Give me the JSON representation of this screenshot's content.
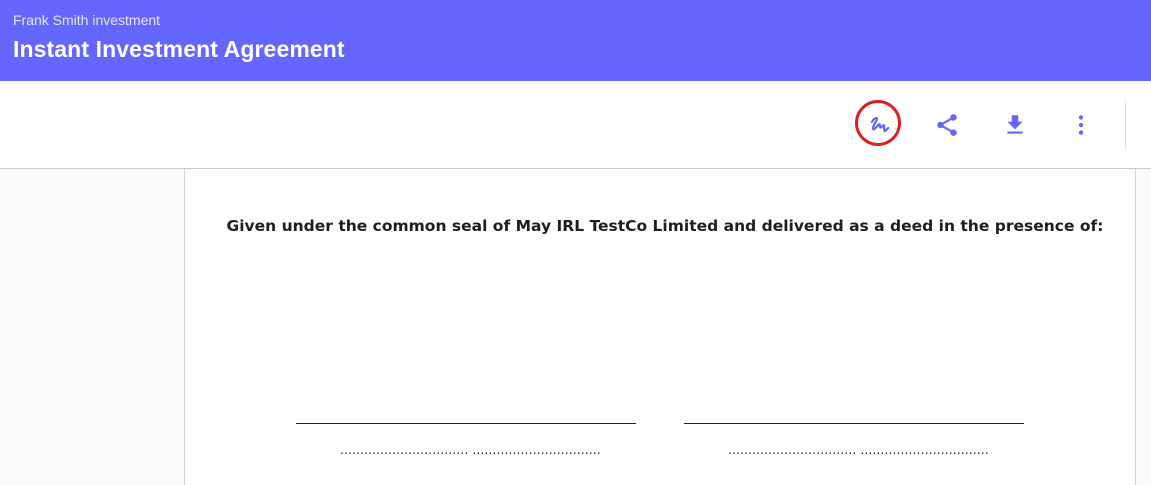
{
  "header": {
    "subtitle": "Frank Smith investment",
    "title": "Instant Investment Agreement",
    "background_color": "#6466fe"
  },
  "toolbar": {
    "buttons": [
      {
        "name": "sign",
        "icon": "signature-icon",
        "highlighted": true,
        "highlight_color": "#e01b24"
      },
      {
        "name": "share",
        "icon": "share-icon"
      },
      {
        "name": "download",
        "icon": "download-icon"
      },
      {
        "name": "more",
        "icon": "more-vert-icon"
      }
    ],
    "icon_color": "#6466fe"
  },
  "document": {
    "deed_text": "Given under the common seal of May IRL TestCo Limited and delivered as a deed in the presence of:",
    "signature_blocks": [
      {
        "dotted_label": "................................ ................................"
      },
      {
        "dotted_label": "................................ ................................"
      }
    ]
  }
}
